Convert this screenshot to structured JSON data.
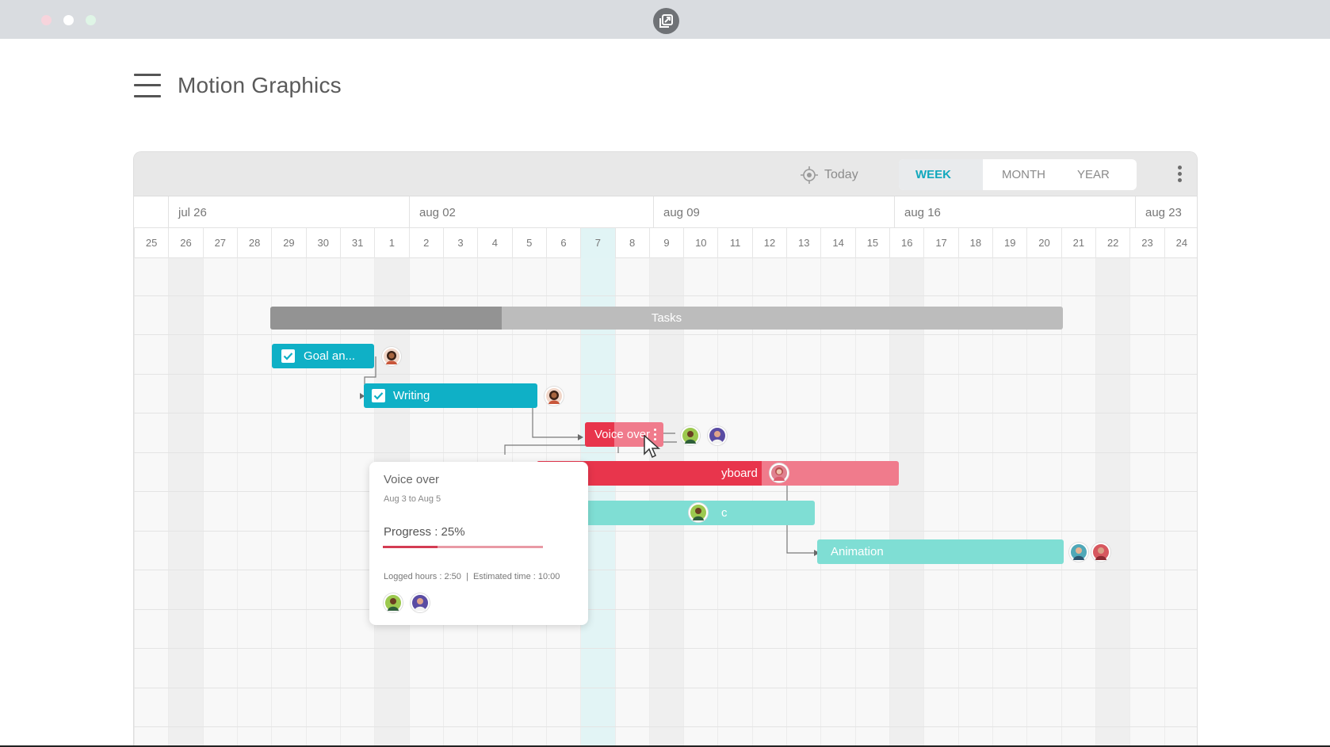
{
  "window": {
    "traffic_lights": [
      "#f7d4dc",
      "#ffffff",
      "#dff5e6"
    ]
  },
  "page": {
    "title": "Motion Graphics"
  },
  "toolbar": {
    "today_label": "Today",
    "views": [
      "WEEK",
      "MONTH",
      "YEAR"
    ],
    "active_view": "WEEK",
    "accent": "#11a8bd"
  },
  "timeline": {
    "months": [
      "jul 26",
      "aug 02",
      "aug 09",
      "aug 16",
      "aug 23"
    ],
    "days": [
      "25",
      "26",
      "27",
      "28",
      "29",
      "30",
      "31",
      "1",
      "2",
      "3",
      "4",
      "5",
      "6",
      "7",
      "8",
      "9",
      "10",
      "11",
      "12",
      "13",
      "14",
      "15",
      "16",
      "17",
      "18",
      "19",
      "20",
      "21",
      "22",
      "23",
      "24"
    ],
    "today": "7"
  },
  "tasks": {
    "group_label": "Tasks",
    "goal": "Goal an...",
    "writing": "Writing",
    "voice_over": "Voice over",
    "storyboard_partial": "yboard",
    "music_partial": "c",
    "animation": "Animation"
  },
  "tooltip": {
    "title": "Voice over",
    "dates": "Aug 3 to Aug 5",
    "progress_label": "Progress : 25%",
    "progress": 0.25,
    "hours": "Logged hours : 2:50  |  Estimated time : 10:00"
  },
  "colors": {
    "teal_dark": "#0fb0c6",
    "teal_light": "#7fded4",
    "red": "#e8354c",
    "pink": "#f07b8c",
    "group_dark": "#939393",
    "group_light": "#bcbcbc"
  }
}
